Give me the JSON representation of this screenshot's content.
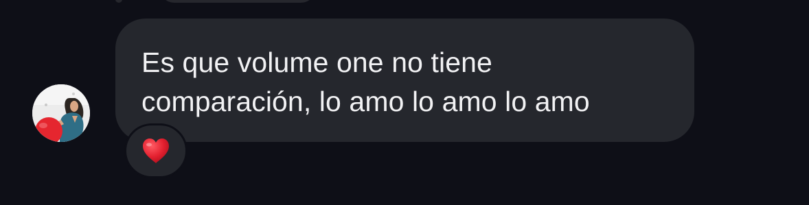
{
  "message": {
    "lines": [
      "Es que volume one no tiene",
      "comparación, lo amo lo amo lo amo"
    ],
    "reaction": "heart-icon"
  },
  "colors": {
    "background": "#0e0f17",
    "bubble": "#25272d",
    "text": "#f2f2f4",
    "heart": "#e3202f"
  }
}
